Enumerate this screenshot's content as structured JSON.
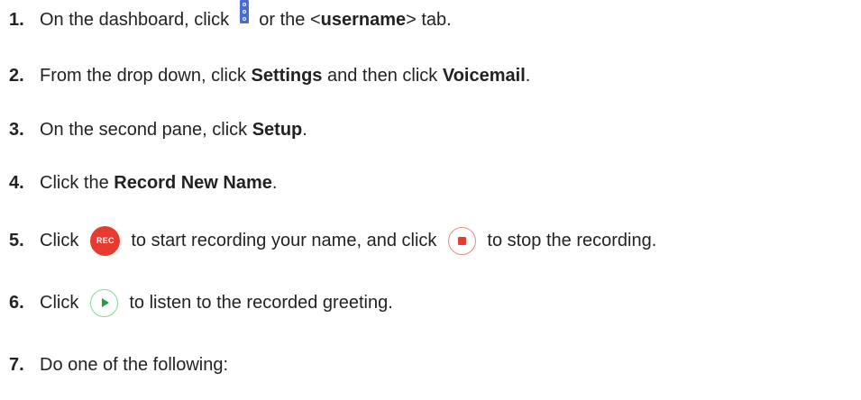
{
  "steps": [
    {
      "num": "1.",
      "a": "On the dashboard, click ",
      "b": " or the <",
      "c": "username",
      "d": "> tab."
    },
    {
      "num": "2.",
      "a": "From the drop down, click ",
      "b": "Settings",
      "c": " and then click ",
      "d": "Voicemail",
      "e": "."
    },
    {
      "num": "3.",
      "a": "On the second pane, click ",
      "b": "Setup",
      "c": "."
    },
    {
      "num": "4.",
      "a": "Click the ",
      "b": "Record New Name",
      "c": "."
    },
    {
      "num": "5.",
      "a": "Click",
      "b": "to start recording your name, and click",
      "c": "to stop the recording."
    },
    {
      "num": "6.",
      "a": "Click",
      "b": "to listen to the recorded greeting."
    },
    {
      "num": "7.",
      "a": "Do one of the following:"
    }
  ],
  "icons": {
    "menu": "vertical-dots-menu-icon",
    "rec_label": "REC",
    "stop": "stop-icon",
    "play": "play-icon"
  },
  "colors": {
    "menu_icon": "#4a6cd8",
    "rec_button": "#e83a2f",
    "stop": "#e83a2f",
    "play": "#1f9e3e"
  }
}
